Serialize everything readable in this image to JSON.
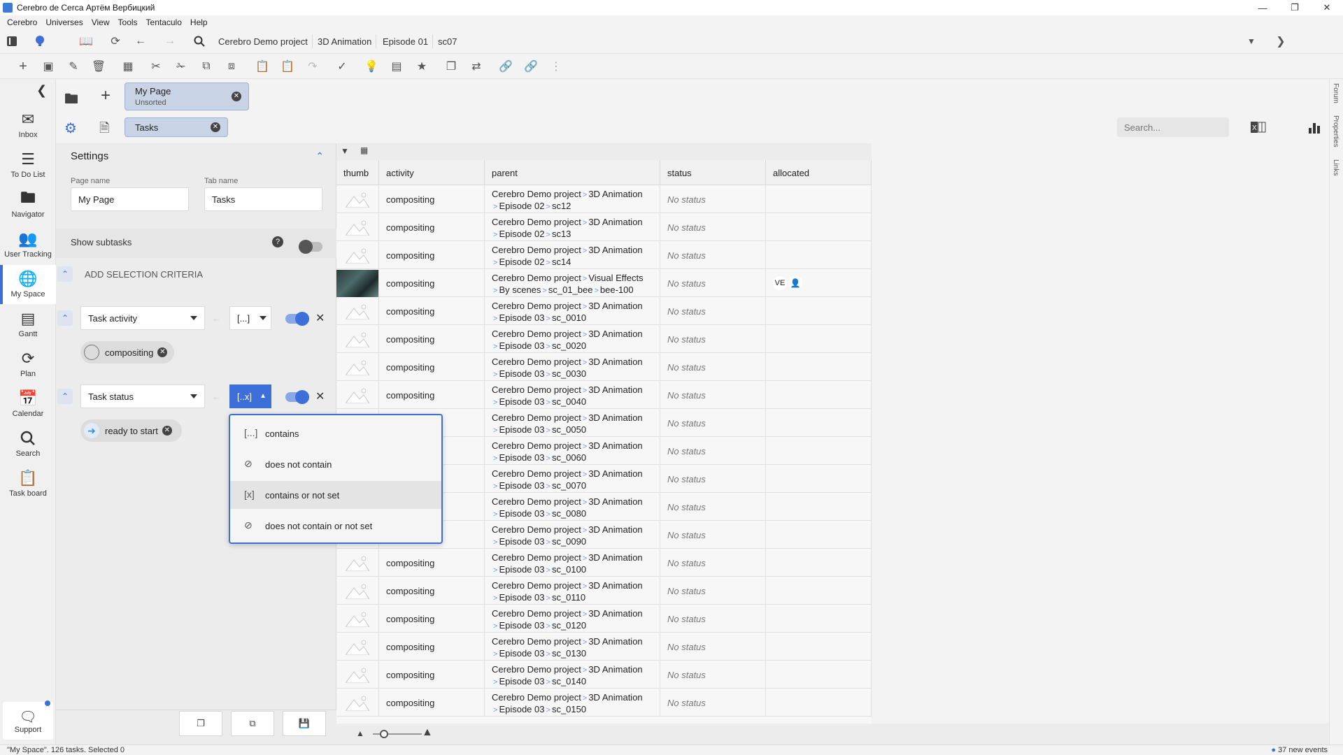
{
  "window": {
    "title": "Cerebro de Cerca  Артём Вербицкий",
    "accent": "#3c6fd8"
  },
  "menu": [
    "Cerebro",
    "Universes",
    "View",
    "Tools",
    "Tentaculo",
    "Help"
  ],
  "toolbar": {
    "notif_count": "37",
    "breadcrumbs": [
      "Cerebro Demo project",
      "3D Animation",
      "Episode 01",
      "sc07"
    ]
  },
  "nav": {
    "items": [
      {
        "label": "Inbox",
        "icon": "inbox-icon"
      },
      {
        "label": "To Do List",
        "icon": "list-icon"
      },
      {
        "label": "Navigator",
        "icon": "folder-icon"
      },
      {
        "label": "User Tracking",
        "icon": "users-icon"
      },
      {
        "label": "My Space",
        "icon": "globe-icon"
      },
      {
        "label": "Gantt",
        "icon": "gantt-icon"
      },
      {
        "label": "Plan",
        "icon": "plan-icon"
      },
      {
        "label": "Calendar",
        "icon": "calendar-icon"
      },
      {
        "label": "Search",
        "icon": "search-icon"
      },
      {
        "label": "Task board",
        "icon": "clipboard-icon"
      }
    ],
    "support": "Support"
  },
  "page_tab": {
    "title": "My Page",
    "subtitle": "Unsorted"
  },
  "sub_tab": {
    "title": "Tasks"
  },
  "search": {
    "placeholder": "Search..."
  },
  "settings": {
    "header": "Settings",
    "page_name_label": "Page name",
    "page_name_value": "My Page",
    "tab_name_label": "Tab name",
    "tab_name_value": "Tasks",
    "show_subtasks": "Show subtasks",
    "add_criteria": "ADD SELECTION CRITERIA",
    "criteria": [
      {
        "field": "Task activity",
        "operator": "[...]",
        "value": "compositing"
      },
      {
        "field": "Task status",
        "operator": "[..x]",
        "value": "ready to start"
      }
    ]
  },
  "operator_menu": {
    "items": [
      "contains",
      "does not contain",
      "contains or not set",
      "does not contain or not set"
    ],
    "selected": "contains or not set"
  },
  "table": {
    "columns": [
      "thumb",
      "activity",
      "parent",
      "status",
      "allocated"
    ],
    "rows": [
      {
        "activity": "compositing",
        "p1": [
          "Cerebro Demo project",
          "3D Animation"
        ],
        "p2": [
          "Episode 02",
          "sc12"
        ],
        "status": "No status",
        "alloc": ""
      },
      {
        "activity": "compositing",
        "p1": [
          "Cerebro Demo project",
          "3D Animation"
        ],
        "p2": [
          "Episode 02",
          "sc13"
        ],
        "status": "No status",
        "alloc": ""
      },
      {
        "activity": "compositing",
        "p1": [
          "Cerebro Demo project",
          "3D Animation"
        ],
        "p2": [
          "Episode 02",
          "sc14"
        ],
        "status": "No status",
        "alloc": ""
      },
      {
        "activity": "compositing",
        "p1": [
          "Cerebro Demo project",
          "Visual Effects"
        ],
        "p2": [
          "By scenes",
          "sc_01_bee",
          "bee-100"
        ],
        "status": "No status",
        "alloc": "VE"
      },
      {
        "activity": "compositing",
        "p1": [
          "Cerebro Demo project",
          "3D Animation"
        ],
        "p2": [
          "Episode 03",
          "sc_0010"
        ],
        "status": "No status",
        "alloc": ""
      },
      {
        "activity": "compositing",
        "p1": [
          "Cerebro Demo project",
          "3D Animation"
        ],
        "p2": [
          "Episode 03",
          "sc_0020"
        ],
        "status": "No status",
        "alloc": ""
      },
      {
        "activity": "compositing",
        "p1": [
          "Cerebro Demo project",
          "3D Animation"
        ],
        "p2": [
          "Episode 03",
          "sc_0030"
        ],
        "status": "No status",
        "alloc": ""
      },
      {
        "activity": "compositing",
        "p1": [
          "Cerebro Demo project",
          "3D Animation"
        ],
        "p2": [
          "Episode 03",
          "sc_0040"
        ],
        "status": "No status",
        "alloc": ""
      },
      {
        "activity": "compositing",
        "p1": [
          "Cerebro Demo project",
          "3D Animation"
        ],
        "p2": [
          "Episode 03",
          "sc_0050"
        ],
        "status": "No status",
        "alloc": ""
      },
      {
        "activity": "compositing",
        "p1": [
          "Cerebro Demo project",
          "3D Animation"
        ],
        "p2": [
          "Episode 03",
          "sc_0060"
        ],
        "status": "No status",
        "alloc": ""
      },
      {
        "activity": "compositing",
        "p1": [
          "Cerebro Demo project",
          "3D Animation"
        ],
        "p2": [
          "Episode 03",
          "sc_0070"
        ],
        "status": "No status",
        "alloc": ""
      },
      {
        "activity": "compositing",
        "p1": [
          "Cerebro Demo project",
          "3D Animation"
        ],
        "p2": [
          "Episode 03",
          "sc_0080"
        ],
        "status": "No status",
        "alloc": ""
      },
      {
        "activity": "compositing",
        "p1": [
          "Cerebro Demo project",
          "3D Animation"
        ],
        "p2": [
          "Episode 03",
          "sc_0090"
        ],
        "status": "No status",
        "alloc": ""
      },
      {
        "activity": "compositing",
        "p1": [
          "Cerebro Demo project",
          "3D Animation"
        ],
        "p2": [
          "Episode 03",
          "sc_0100"
        ],
        "status": "No status",
        "alloc": ""
      },
      {
        "activity": "compositing",
        "p1": [
          "Cerebro Demo project",
          "3D Animation"
        ],
        "p2": [
          "Episode 03",
          "sc_0110"
        ],
        "status": "No status",
        "alloc": ""
      },
      {
        "activity": "compositing",
        "p1": [
          "Cerebro Demo project",
          "3D Animation"
        ],
        "p2": [
          "Episode 03",
          "sc_0120"
        ],
        "status": "No status",
        "alloc": ""
      },
      {
        "activity": "compositing",
        "p1": [
          "Cerebro Demo project",
          "3D Animation"
        ],
        "p2": [
          "Episode 03",
          "sc_0130"
        ],
        "status": "No status",
        "alloc": ""
      },
      {
        "activity": "compositing",
        "p1": [
          "Cerebro Demo project",
          "3D Animation"
        ],
        "p2": [
          "Episode 03",
          "sc_0140"
        ],
        "status": "No status",
        "alloc": ""
      },
      {
        "activity": "compositing",
        "p1": [
          "Cerebro Demo project",
          "3D Animation"
        ],
        "p2": [
          "Episode 03",
          "sc_0150"
        ],
        "status": "No status",
        "alloc": ""
      }
    ]
  },
  "side_tabs": [
    "Forum",
    "Properties",
    "Links"
  ],
  "status_bar": {
    "left": "\"My Space\". 126 tasks. Selected 0",
    "right": "37 new events"
  }
}
